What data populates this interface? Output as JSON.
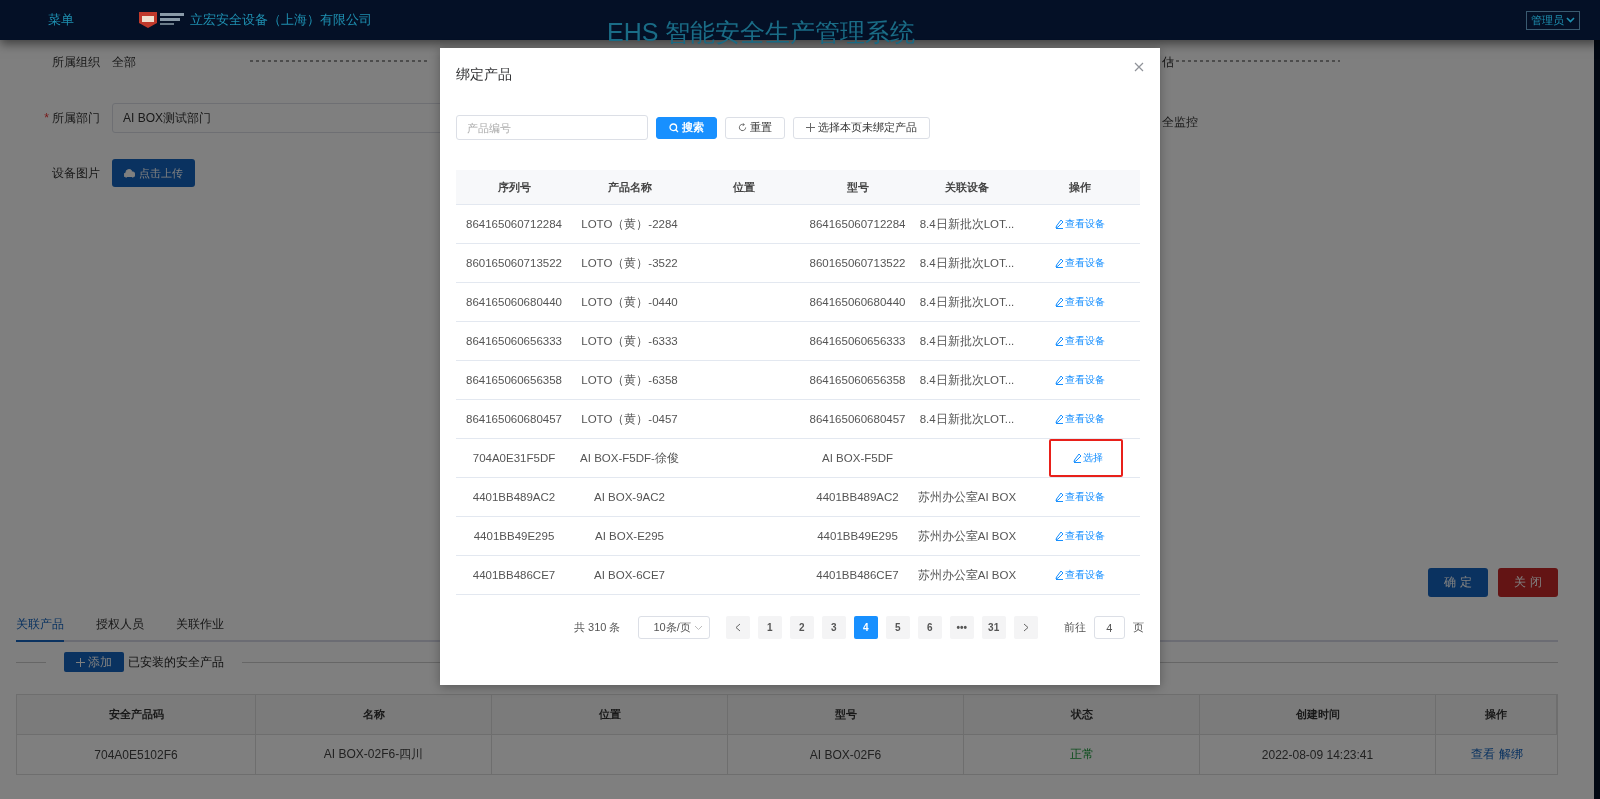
{
  "header": {
    "menu": "菜单",
    "company": "立宏安全设备（上海）有限公司",
    "title": "EHS 智能安全生产管理系统",
    "user": "管理员"
  },
  "form": {
    "org_label": "所属组织",
    "org_value": "全部",
    "dept_label": "所属部门",
    "dept_required": true,
    "required_mark": "*",
    "dept_value": "AI BOX测试部门",
    "image_label": "设备图片",
    "upload": "点击上传",
    "right_texts": [
      "估",
      "全监控"
    ]
  },
  "actions": {
    "confirm": "确 定",
    "close": "关 闭"
  },
  "tabs": [
    {
      "label": "关联产品",
      "selected": true
    },
    {
      "label": "授权人员",
      "selected": false
    },
    {
      "label": "关联作业",
      "selected": false
    }
  ],
  "installed": {
    "add": "添加",
    "caption": "已安装的安全产品"
  },
  "products_table": {
    "columns": [
      "安全产品码",
      "名称",
      "位置",
      "型号",
      "状态",
      "创建时间",
      "操作"
    ],
    "rows": [
      {
        "code": "704A0E5102F6",
        "name": "AI BOX-02F6-四川",
        "location": "",
        "model": "AI BOX-02F6",
        "status": "正常",
        "created": "2022-08-09 14:23:41",
        "actions": [
          "查看",
          "解绑"
        ]
      }
    ]
  },
  "modal": {
    "title": "绑定产品",
    "search_placeholder": "产品编号",
    "search": "搜索",
    "reset": "重置",
    "select_unbound": "选择本页未绑定产品",
    "columns": [
      "序列号",
      "产品名称",
      "位置",
      "型号",
      "关联设备",
      "操作"
    ],
    "rows": [
      {
        "serial": "864165060712284",
        "name": "LOTO（黄）-2284",
        "model": "864165060712284",
        "device": "8.4日新批次LOT...",
        "action": "查看设备",
        "kind": "view",
        "highlighted": false
      },
      {
        "serial": "860165060713522",
        "name": "LOTO（黄）-3522",
        "model": "860165060713522",
        "device": "8.4日新批次LOT...",
        "action": "查看设备",
        "kind": "view",
        "highlighted": false
      },
      {
        "serial": "864165060680440",
        "name": "LOTO（黄）-0440",
        "model": "864165060680440",
        "device": "8.4日新批次LOT...",
        "action": "查看设备",
        "kind": "view",
        "highlighted": false
      },
      {
        "serial": "864165060656333",
        "name": "LOTO（黄）-6333",
        "model": "864165060656333",
        "device": "8.4日新批次LOT...",
        "action": "查看设备",
        "kind": "view",
        "highlighted": false
      },
      {
        "serial": "864165060656358",
        "name": "LOTO（黄）-6358",
        "model": "864165060656358",
        "device": "8.4日新批次LOT...",
        "action": "查看设备",
        "kind": "view",
        "highlighted": false
      },
      {
        "serial": "864165060680457",
        "name": "LOTO（黄）-0457",
        "model": "864165060680457",
        "device": "8.4日新批次LOT...",
        "action": "查看设备",
        "kind": "view",
        "highlighted": false
      },
      {
        "serial": "704A0E31F5DF",
        "name": "AI BOX-F5DF-徐俊",
        "model": "AI BOX-F5DF",
        "device": "",
        "action": "选择",
        "kind": "select",
        "highlighted": true
      },
      {
        "serial": "4401BB489AC2",
        "name": "AI BOX-9AC2",
        "model": "4401BB489AC2",
        "device": "苏州办公室AI BOX",
        "action": "查看设备",
        "kind": "view",
        "highlighted": false
      },
      {
        "serial": "4401BB49E295",
        "name": "AI BOX-E295",
        "model": "4401BB49E295",
        "device": "苏州办公室AI BOX",
        "action": "查看设备",
        "kind": "view",
        "highlighted": false
      },
      {
        "serial": "4401BB486CE7",
        "name": "AI BOX-6CE7",
        "model": "4401BB486CE7",
        "device": "苏州办公室AI BOX",
        "action": "查看设备",
        "kind": "view",
        "highlighted": false
      }
    ],
    "pagination": {
      "total": "共 310 条",
      "page_size": "10条/页",
      "pages": [
        {
          "label": "1",
          "selected": false
        },
        {
          "label": "2",
          "selected": false
        },
        {
          "label": "3",
          "selected": false
        },
        {
          "label": "4",
          "selected": true
        },
        {
          "label": "5",
          "selected": false
        },
        {
          "label": "6",
          "selected": false
        },
        {
          "label": "•••",
          "selected": false
        },
        {
          "label": "31",
          "selected": false
        }
      ],
      "goto": "前往",
      "goto_value": "4",
      "page_unit": "页"
    }
  }
}
